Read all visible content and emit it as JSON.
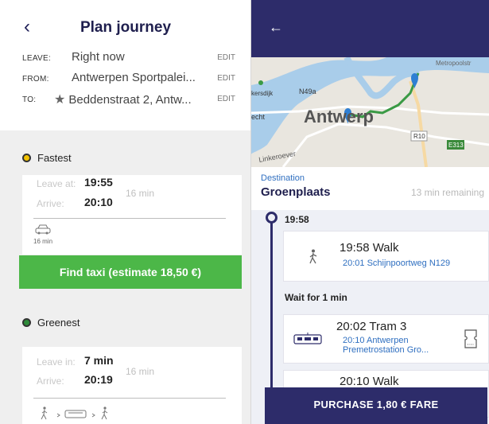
{
  "plan": {
    "title": "Plan journey",
    "leave_label": "LEAVE:",
    "leave_value": "Right now",
    "from_label": "FROM:",
    "from_value": "Antwerpen Sportpalei...",
    "to_label": "TO:",
    "to_value": "Beddenstraat 2, Antw...",
    "edit_label": "EDIT"
  },
  "fastest": {
    "heading": "Fastest",
    "dot_color": "#f2c200",
    "leave_label": "Leave at:",
    "leave_time": "19:55",
    "arrive_label": "Arrive:",
    "arrive_time": "20:10",
    "duration": "16 min",
    "mode_duration": "16 min",
    "taxi_button": "Find taxi (estimate 18,50 €)"
  },
  "greenest": {
    "heading": "Greenest",
    "dot_color": "#2e8b3a",
    "leave_label": "Leave in:",
    "leave_value": "7 min",
    "arrive_label": "Arrive:",
    "arrive_time": "20:19",
    "duration": "16 min"
  },
  "journey": {
    "destination_label": "Destination",
    "destination_name": "Groenplaats",
    "remaining": "13 min remaining",
    "start_time": "19:58",
    "steps": [
      {
        "title": "19:58 Walk",
        "sub": "20:01 Schijnpoortweg N129"
      },
      {
        "title": "20:02 Tram 3",
        "sub_line1": "20:10 Antwerpen",
        "sub_line2": "Premetrostation Gro..."
      },
      {
        "title": "20:10 Walk"
      }
    ],
    "wait_text": "Wait for 1 min",
    "purchase_button": "PURCHASE 1,80 € FARE"
  },
  "map": {
    "labels": [
      "Metropoolstr",
      "kersdijk",
      "N49a",
      "echt",
      "Antwerp",
      "R10",
      "E313",
      "Linkeroever"
    ]
  },
  "colors": {
    "navy": "#2d2c6a",
    "green_button": "#4cb748",
    "link_blue": "#2f6fc0"
  }
}
